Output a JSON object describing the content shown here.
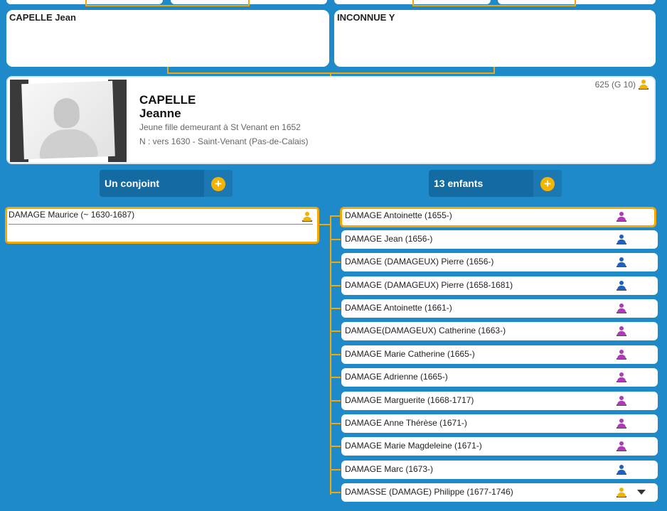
{
  "parents": {
    "father": {
      "name": "CAPELLE Jean"
    },
    "mother": {
      "name": "INCONNUE Y"
    }
  },
  "person": {
    "surname": "CAPELLE",
    "firstname": "Jeanne",
    "occupation": "Jeune fille demeurant à St Venant en 1652",
    "birth": "N : vers 1630 - Saint-Venant (Pas-de-Calais)",
    "sosa": "625 (G 10)",
    "sex_icon": "person-icon",
    "photo_icon": "silhouette-placeholder"
  },
  "sections": {
    "spouses": {
      "label": "Un conjoint",
      "add": "+"
    },
    "children": {
      "label": "13 enfants",
      "add": "+"
    }
  },
  "spouse": {
    "name": "DAMAGE Maurice (~ 1630-1687)",
    "icon": "person-icon"
  },
  "children": [
    {
      "name": "DAMAGE Antoinette (1655-)",
      "sex": "female"
    },
    {
      "name": "DAMAGE Jean (1656-)",
      "sex": "male"
    },
    {
      "name": "DAMAGE (DAMAGEUX) Pierre (1656-)",
      "sex": "male"
    },
    {
      "name": "DAMAGE (DAMAGEUX) Pierre (1658-1681)",
      "sex": "male"
    },
    {
      "name": "DAMAGE Antoinette (1661-)",
      "sex": "female"
    },
    {
      "name": "DAMAGE(DAMAGEUX) Catherine (1663-)",
      "sex": "female"
    },
    {
      "name": "DAMAGE Marie Catherine (1665-)",
      "sex": "female"
    },
    {
      "name": "DAMAGE Adrienne (1665-)",
      "sex": "female"
    },
    {
      "name": "DAMAGE Marguerite (1668-1717)",
      "sex": "female"
    },
    {
      "name": "DAMAGE Anne Thérèse (1671-)",
      "sex": "female"
    },
    {
      "name": "DAMAGE Marie Magdeleine (1671-)",
      "sex": "female"
    },
    {
      "name": "DAMAGE Marc (1673-)",
      "sex": "male"
    },
    {
      "name": "DAMASSE (DAMAGE) Philippe (1677-1746)",
      "sex": "unknown"
    }
  ],
  "colors": {
    "background": "#1f8ac9",
    "accent": "#f5a800",
    "male": "#1f5fc0",
    "female": "#b03ab8",
    "unknown": "#f0b400",
    "section": "#136ba1"
  }
}
